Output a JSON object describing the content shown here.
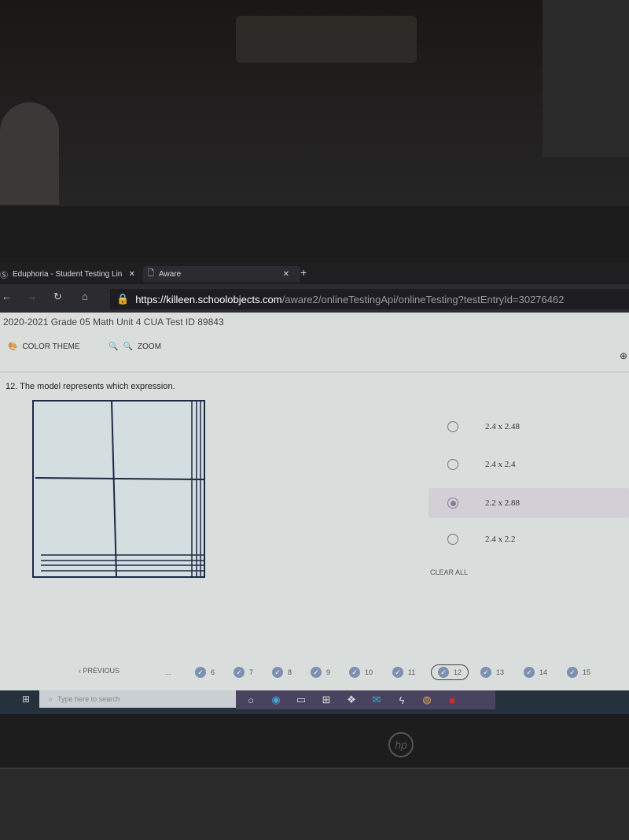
{
  "browser": {
    "tabs": [
      {
        "label": "Eduphoria - Student Testing Lin",
        "icon": "eduphoria-icon"
      },
      {
        "label": "Aware",
        "icon": "page-icon",
        "active": true
      }
    ],
    "url_host": "https://killeen.schoolobjects.com",
    "url_path": "/aware2/onlineTestingApi/onlineTesting?testEntryId=30276462"
  },
  "test": {
    "title": "2020-2021 Grade 05 Math Unit 4 CUA Test ID 89843",
    "toolbar": {
      "color_theme": "COLOR THEME",
      "zoom": "ZOOM"
    },
    "question": "12. The model represents which expression.",
    "options": [
      {
        "label": "2.4 x 2.48",
        "selected": false
      },
      {
        "label": "2.4 x 2.4",
        "selected": false
      },
      {
        "label": "2.2 x 2.88",
        "selected": true
      },
      {
        "label": "2.4 x 2.2",
        "selected": false
      }
    ],
    "clear_all": "CLEAR ALL",
    "nav": {
      "previous": "PREVIOUS",
      "ellipsis": "...",
      "questions": [
        "6",
        "7",
        "8",
        "9",
        "10",
        "11",
        "12",
        "13",
        "14",
        "15"
      ],
      "current": "12"
    }
  },
  "taskbar": {
    "search_placeholder": "Type here to search"
  },
  "colors": {
    "selected_option": "#d3cfd6",
    "answered_check": "#7d90b0",
    "page_bg": "#d9dedd"
  }
}
